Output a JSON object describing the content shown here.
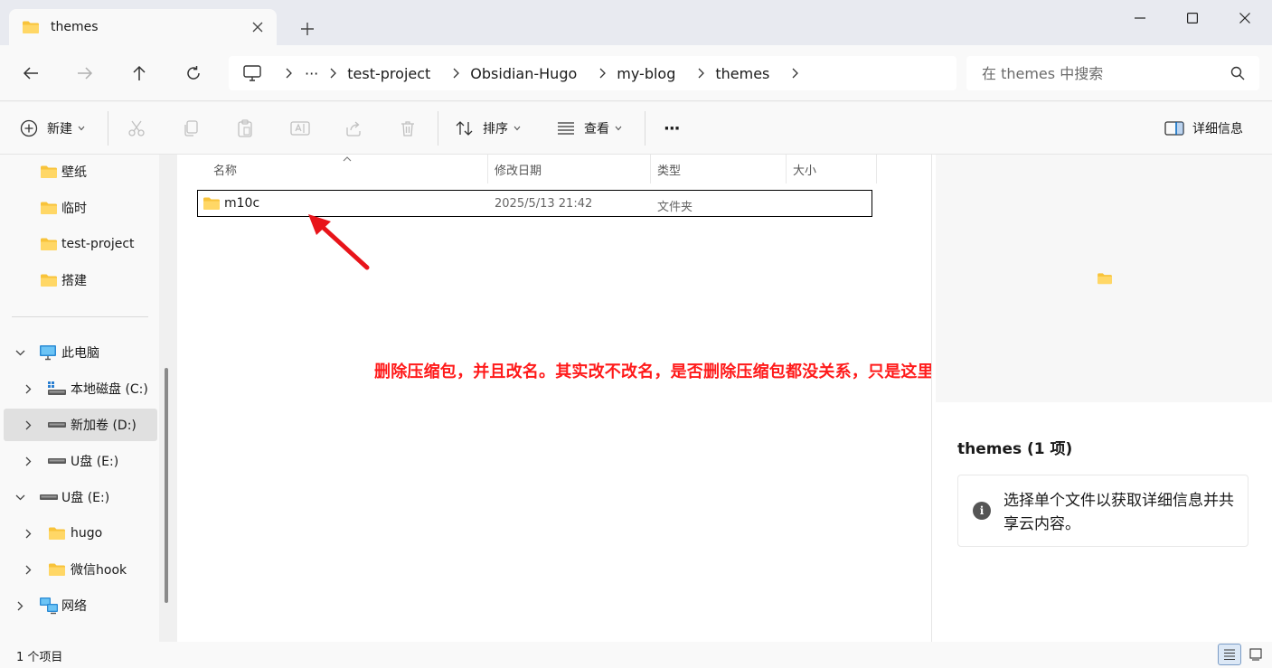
{
  "window": {
    "tab_title": "themes",
    "tab_close_icon": "close-icon",
    "new_tab_icon": "plus-icon",
    "controls": [
      "minimize-icon",
      "maximize-icon",
      "close-icon"
    ]
  },
  "nav": {
    "back_icon": "arrow-left-icon",
    "forward_icon": "arrow-right-icon",
    "up_icon": "arrow-up-icon",
    "refresh_icon": "refresh-icon"
  },
  "address": {
    "overflow": "···",
    "crumbs": [
      "test-project",
      "Obsidian-Hugo",
      "my-blog",
      "themes"
    ]
  },
  "search": {
    "placeholder": "在 themes 中搜索"
  },
  "toolbar": {
    "new_label": "新建",
    "sort_label": "排序",
    "view_label": "查看",
    "more_label": "···",
    "details_label": "详细信息"
  },
  "sidebar": {
    "items": [
      {
        "label": "壁纸",
        "icon": "folder-icon"
      },
      {
        "label": "临时",
        "icon": "folder-icon"
      },
      {
        "label": "test-project",
        "icon": "folder-icon"
      },
      {
        "label": "搭建",
        "icon": "folder-icon"
      },
      {
        "label": "此电脑",
        "icon": "computer-icon"
      },
      {
        "label": "本地磁盘 (C:)",
        "icon": "drive-icon"
      },
      {
        "label": "新加卷 (D:)",
        "icon": "drive-icon"
      },
      {
        "label": "U盘 (E:)",
        "icon": "usb-drive-icon"
      },
      {
        "label": "U盘 (E:)",
        "icon": "usb-drive-icon"
      },
      {
        "label": "hugo",
        "icon": "folder-icon"
      },
      {
        "label": "微信hook",
        "icon": "folder-icon"
      },
      {
        "label": "网络",
        "icon": "network-icon"
      }
    ]
  },
  "filelist": {
    "columns": [
      "名称",
      "修改日期",
      "类型",
      "大小"
    ],
    "rows": [
      {
        "name": "m10c",
        "modified": "2025/5/13 21:42",
        "type": "文件夹",
        "size": ""
      }
    ]
  },
  "annotation": {
    "text": "删除压缩包，并且改名。其实改不改名，是否删除压缩包都没关系，只是这里舒服一点。",
    "color": "#ff1a1a"
  },
  "details": {
    "title": "themes (1 项)",
    "info": "选择单个文件以获取详细信息并共享云内容。"
  },
  "status": {
    "count": "1 个项目"
  },
  "colors": {
    "folder": "#f8c33a",
    "accent": "#0067c0"
  }
}
